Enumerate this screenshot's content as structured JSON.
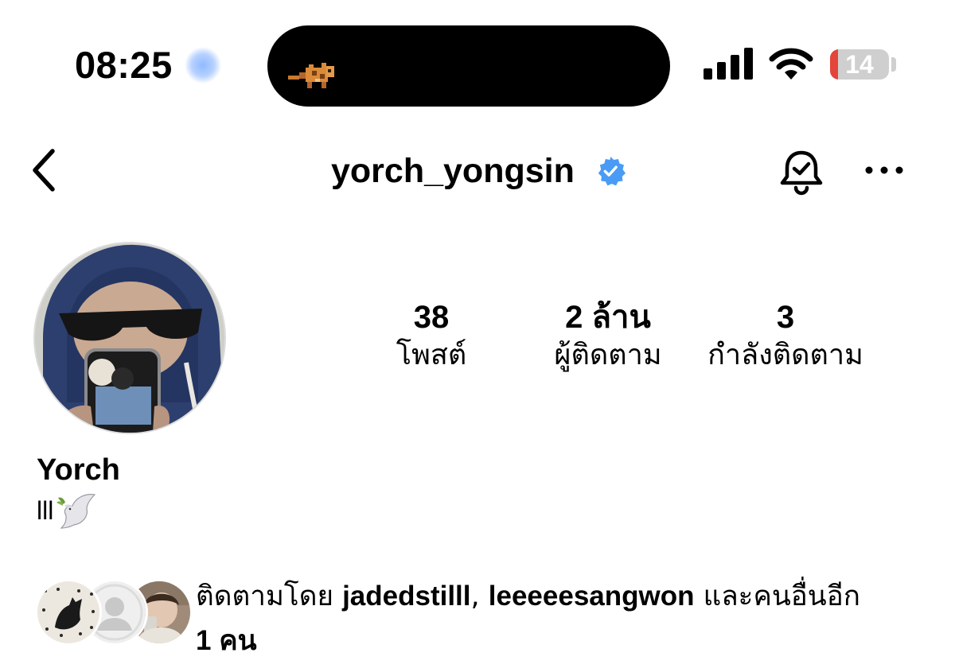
{
  "status_bar": {
    "time": "08:25",
    "battery_level": "14",
    "battery_fraction": 0.14,
    "icons": [
      "focus-indicator",
      "pixel-cat-activity",
      "cellular-signal",
      "wifi",
      "battery"
    ]
  },
  "header": {
    "username": "yorch_yongsin",
    "verified": true,
    "icons": [
      "back-chevron",
      "verified-badge",
      "bell-check",
      "more-horizontal"
    ]
  },
  "profile": {
    "display_name": "Yorch",
    "bio_text": "lll",
    "bio_emoji": "dove-with-olive-branch"
  },
  "stats": {
    "posts": {
      "value": "38",
      "label": "โพสต์"
    },
    "followers": {
      "value": "2 ล้าน",
      "label": "ผู้ติดตาม"
    },
    "following": {
      "value": "3",
      "label": "กำลังติดตาม"
    }
  },
  "followed_by": {
    "prefix": "ติดตามโดย ",
    "user1": "jadedstilll",
    "separator": ", ",
    "user2": "leeeeesangwon",
    "and_others": " และคนอื่นอีก",
    "others_count": "1 คน"
  },
  "colors": {
    "verified_blue": "#4a9bf5",
    "battery_low_red": "#e5443a",
    "island_black": "#000000"
  }
}
